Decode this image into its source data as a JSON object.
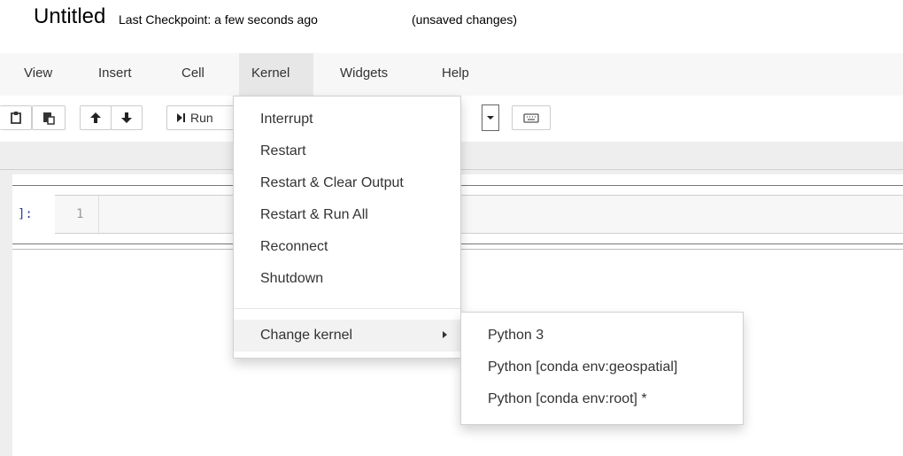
{
  "header": {
    "title": "Untitled",
    "checkpoint": "Last Checkpoint: a few seconds ago",
    "unsaved": "(unsaved changes)"
  },
  "menubar": {
    "items": [
      "View",
      "Insert",
      "Cell",
      "Kernel",
      "Widgets",
      "Help"
    ]
  },
  "toolbar": {
    "run_label": "Run"
  },
  "cell": {
    "prompt": "]:",
    "line_number": "1"
  },
  "kernel_menu": {
    "items": [
      "Interrupt",
      "Restart",
      "Restart & Clear Output",
      "Restart & Run All",
      "Reconnect",
      "Shutdown"
    ],
    "change_kernel": "Change kernel",
    "submenu": [
      "Python 3",
      "Python [conda env:geospatial]",
      "Python [conda env:root] *"
    ]
  },
  "colors": {
    "menubar_bg": "#f7f7f7",
    "open_menu_bg": "#e7e7e7",
    "notebook_bg": "#eeeeee",
    "prompt_color": "#303f9f"
  },
  "icons": {
    "toolbar": [
      "paste-icon",
      "paste-below-icon",
      "arrow-up-icon",
      "arrow-down-icon",
      "run-step-icon",
      "keyboard-icon",
      "dropdown-arrow-icon"
    ],
    "menu": [
      "submenu-caret-icon"
    ]
  }
}
